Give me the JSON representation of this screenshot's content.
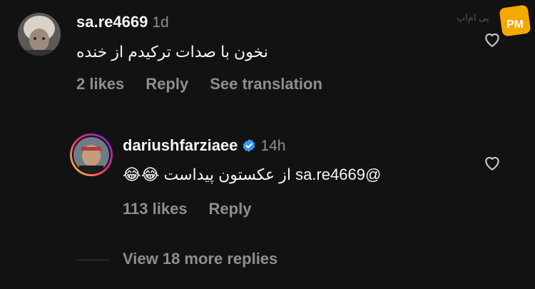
{
  "comment1": {
    "username": "sa.re4669",
    "time": "1d",
    "text": "نخون با صدات ترکیدم از خنده",
    "likes": "2 likes",
    "reply": "Reply",
    "see_translation": "See translation"
  },
  "comment2": {
    "username": "dariushfarziaee",
    "time": "14h",
    "text": "@sa.re4669 از عکستون پیداست 😂😂",
    "likes": "113 likes",
    "reply": "Reply"
  },
  "view_more": "View 18 more replies",
  "watermark": {
    "text": "پی ام‌اپ",
    "logo_text": "PM",
    "logo_color": "#f5a800"
  }
}
